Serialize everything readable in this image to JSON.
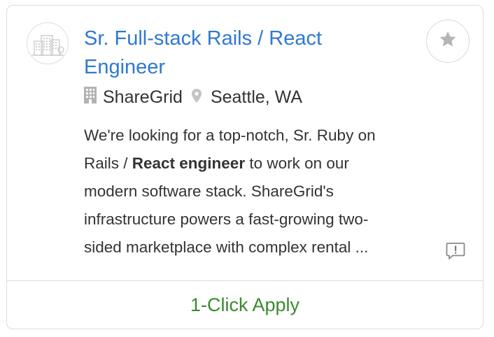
{
  "job": {
    "title_line1": "Sr. Full-stack Rails / React",
    "title_line2": "Engineer",
    "company": "ShareGrid",
    "location": "Seattle, WA",
    "description": {
      "line1": "We're looking for a top-notch, Sr. Ruby on",
      "line2_pre": "Rails / ",
      "line2_bold": "React engineer",
      "line2_post": " to work on our",
      "line3": "modern software stack. ShareGrid's",
      "line4": "infrastructure powers a fast-growing two-",
      "line5": "sided marketplace with complex rental ..."
    }
  },
  "actions": {
    "apply_label": "1-Click Apply"
  },
  "icons": {
    "logo": "building-city-icon",
    "company": "building-icon",
    "location": "map-pin-icon",
    "favorite": "star-icon",
    "report": "report-flag-icon"
  },
  "colors": {
    "title_link": "#2f79d1",
    "apply_text": "#3a8a2e",
    "border": "#dcdcdc",
    "icon_gray": "#b0b0b0"
  }
}
